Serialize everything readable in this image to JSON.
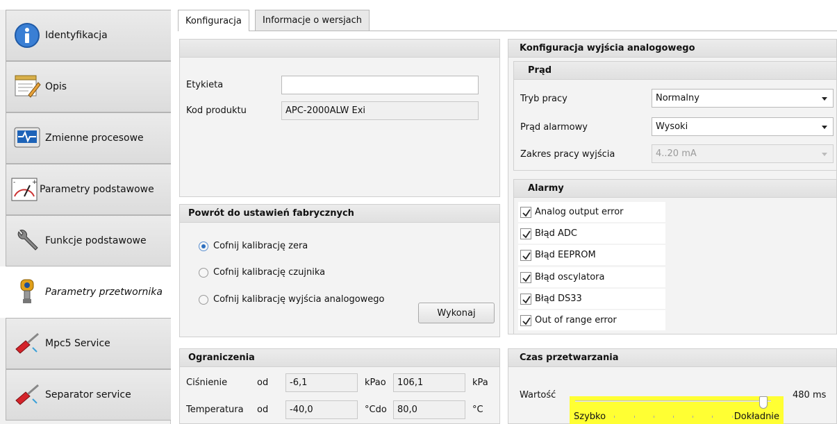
{
  "sidebar": {
    "items": [
      {
        "label": "Identyfikacja",
        "icon": "info-icon"
      },
      {
        "label": "Opis",
        "icon": "notepad-icon"
      },
      {
        "label": "Zmienne procesowe",
        "icon": "monitor-pulse-icon"
      },
      {
        "label": "Parametry podstawowe",
        "icon": "gauge-icon"
      },
      {
        "label": "Funkcje podstawowe",
        "icon": "wrench-icon"
      },
      {
        "label": "Parametry przetwornika",
        "icon": "transmitter-icon",
        "active": true
      },
      {
        "label": "Mpc5 Service",
        "icon": "screwdriver-icon"
      },
      {
        "label": "Separator service",
        "icon": "screwdriver-icon"
      }
    ]
  },
  "tabs": [
    {
      "label": "Konfiguracja",
      "active": true
    },
    {
      "label": "Informacje o wersjach",
      "active": false
    }
  ],
  "general": {
    "etykieta_label": "Etykieta",
    "etykieta_value": "",
    "kod_label": "Kod produktu",
    "kod_value": "APC-2000ALW Exi"
  },
  "factory_reset": {
    "title": "Powrót do ustawień fabrycznych",
    "options": [
      {
        "label": "Cofnij kalibrację zera",
        "selected": true
      },
      {
        "label": "Cofnij kalibrację czujnika",
        "selected": false
      },
      {
        "label": "Cofnij kalibrację wyjścia analogowego",
        "selected": false
      }
    ],
    "execute_label": "Wykonaj"
  },
  "limits": {
    "title": "Ograniczenia",
    "pressure_label": "Ciśnienie",
    "pressure_from_label": "od",
    "pressure_from": "-6,1",
    "pressure_unit_to": "kPao",
    "pressure_to": "106,1",
    "pressure_unit": "kPa",
    "temp_label": "Temperatura",
    "temp_from_label": "od",
    "temp_from": "-40,0",
    "temp_unit_to": "°Cdo",
    "temp_to": "80,0",
    "temp_unit": "°C"
  },
  "analog_output": {
    "title": "Konfiguracja wyjścia analogowego",
    "current": {
      "title": "Prąd",
      "mode_label": "Tryb pracy",
      "mode_value": "Normalny",
      "alarm_label": "Prąd alarmowy",
      "alarm_value": "Wysoki",
      "range_label": "Zakres pracy wyjścia",
      "range_value": "4..20 mA"
    },
    "alarms": {
      "title": "Alarmy",
      "items": [
        {
          "label": "Analog output error",
          "checked": true
        },
        {
          "label": "Błąd ADC",
          "checked": true
        },
        {
          "label": "Błąd EEPROM",
          "checked": true
        },
        {
          "label": "Błąd oscylatora",
          "checked": true
        },
        {
          "label": "Błąd DS33",
          "checked": true
        },
        {
          "label": "Out of range error",
          "checked": true
        }
      ]
    }
  },
  "processing_time": {
    "title": "Czas przetwarzania",
    "value_label": "Wartość",
    "value_text": "480 ms",
    "slider_min_label": "Szybko",
    "slider_max_label": "Dokładnie",
    "slider_fraction": 0.96,
    "highlight_color": "#ffff33"
  }
}
